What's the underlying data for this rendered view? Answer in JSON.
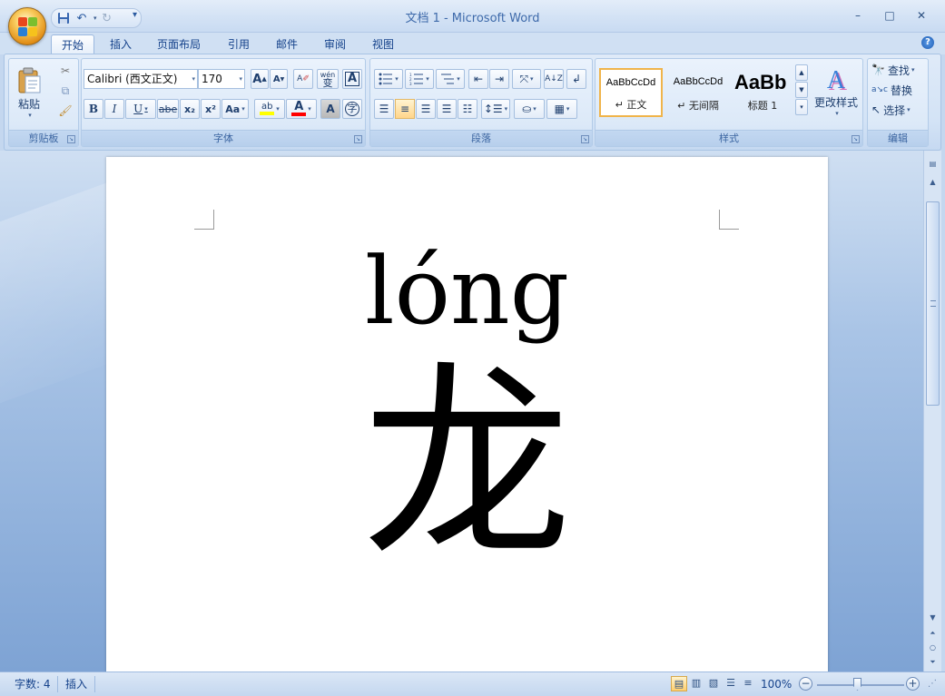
{
  "window": {
    "title": "文档 1 - Microsoft Word",
    "minimize": "–",
    "maximize": "□",
    "close": "✕"
  },
  "qat": {
    "save_icon": "save-icon",
    "undo_icon": "undo-icon",
    "redo_icon": "redo-icon",
    "customize": "▾"
  },
  "tabs": [
    {
      "label": "开始",
      "active": true
    },
    {
      "label": "插入"
    },
    {
      "label": "页面布局"
    },
    {
      "label": "引用"
    },
    {
      "label": "邮件"
    },
    {
      "label": "审阅"
    },
    {
      "label": "视图"
    }
  ],
  "help": "?",
  "clipboard": {
    "paste_label": "粘贴",
    "group_label": "剪贴板"
  },
  "font": {
    "font_name": "Calibri (西文正文)",
    "font_size": "170",
    "group_label": "字体",
    "grow": "A",
    "shrink": "A",
    "clear_format": "A",
    "phonetic": "wén",
    "border_char": "A",
    "bold": "B",
    "italic": "I",
    "underline": "U",
    "strike": "abe",
    "subscript": "x₂",
    "superscript": "x²",
    "change_case": "Aa",
    "highlight": "ab",
    "font_color": "A",
    "char_shading": "A",
    "enclose_char": "字"
  },
  "paragraph": {
    "group_label": "段落"
  },
  "styles": {
    "group_label": "样式",
    "items": [
      {
        "preview": "AaBbCcDd",
        "name": "↵ 正文"
      },
      {
        "preview": "AaBbCcDd",
        "name": "↵ 无间隔"
      },
      {
        "preview": "AaBb",
        "name": "标题 1"
      }
    ],
    "change_styles": "更改样式"
  },
  "editing": {
    "group_label": "编辑",
    "find": "查找",
    "replace": "替换",
    "select": "选择"
  },
  "document": {
    "pinyin": "lóng",
    "hanzi": "龙"
  },
  "status": {
    "word_count": "字数: 4",
    "mode": "插入",
    "zoom": "100%",
    "zoom_value": 1.0
  },
  "colors": {
    "highlight_bar": "#ffff00",
    "font_color_bar": "#ff0000",
    "accent_text": "#15428b"
  }
}
